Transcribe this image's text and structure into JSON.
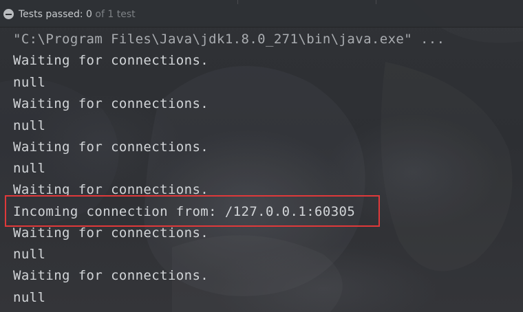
{
  "test_status": {
    "label": "Tests passed: ",
    "passed": "0",
    "rest": " of 1 test"
  },
  "console": {
    "lines": [
      "\"C:\\Program Files\\Java\\jdk1.8.0_271\\bin\\java.exe\" ...",
      "Waiting for connections.",
      "null",
      "Waiting for connections.",
      "null",
      "Waiting for connections.",
      "null",
      "Waiting for connections.",
      "Incoming connection from: /127.0.0.1:60305",
      "Waiting for connections.",
      "null",
      "Waiting for connections.",
      "null"
    ]
  },
  "colors": {
    "highlight": "#e0393a",
    "console_text": "#d2d5d8",
    "background": "#2d2f33"
  }
}
